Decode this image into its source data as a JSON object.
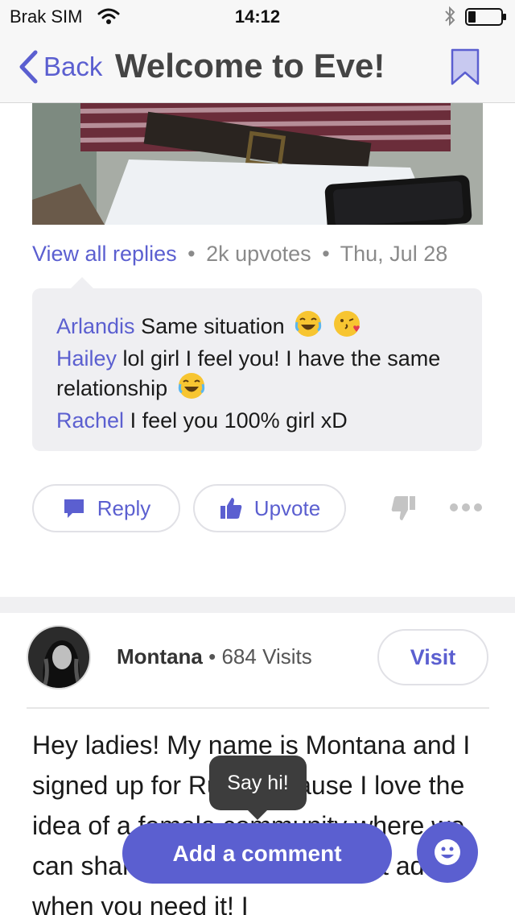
{
  "status_bar": {
    "carrier": "Brak SIM",
    "time": "14:12"
  },
  "nav": {
    "back_label": "Back",
    "title": "Welcome to Eve!"
  },
  "post_meta": {
    "view_replies": "View all replies",
    "upvotes": "2k upvotes",
    "date": "Thu, Jul 28",
    "separator": "•"
  },
  "replies": [
    {
      "author": "Arlandis",
      "text": "Same situation",
      "emojis": [
        "joy",
        "kiss"
      ]
    },
    {
      "author": "Hailey",
      "text": "lol girl I feel you! I have the same relationship",
      "emojis": [
        "joy"
      ]
    },
    {
      "author": "Rachel",
      "text": "I feel you 100% girl xD",
      "emojis": []
    }
  ],
  "actions": {
    "reply_label": "Reply",
    "upvote_label": "Upvote"
  },
  "next_post": {
    "author": "Montana",
    "separator": "•",
    "visits": "684 Visits",
    "visit_label": "Visit",
    "body": "Hey ladies! My name is Montana and I signed up for Ruby because I love the idea of a female community where we can share and feel free and get advice when you need it! I"
  },
  "tooltip": {
    "text": "Say hi!"
  },
  "compose": {
    "add_comment_label": "Add a comment"
  },
  "colors": {
    "accent": "#5b5fd0",
    "muted_text": "#8a8a8a",
    "reply_bg": "#efeff2"
  },
  "icons": {
    "wifi": "wifi-icon",
    "bluetooth": "bluetooth-icon",
    "battery": "battery-icon",
    "back": "chevron-left-icon",
    "bookmark": "bookmark-icon",
    "reply": "speech-bubble-icon",
    "upvote": "thumbs-up-icon",
    "downvote": "thumbs-down-icon",
    "more": "more-dots-icon",
    "emoji_picker": "smiley-icon"
  }
}
